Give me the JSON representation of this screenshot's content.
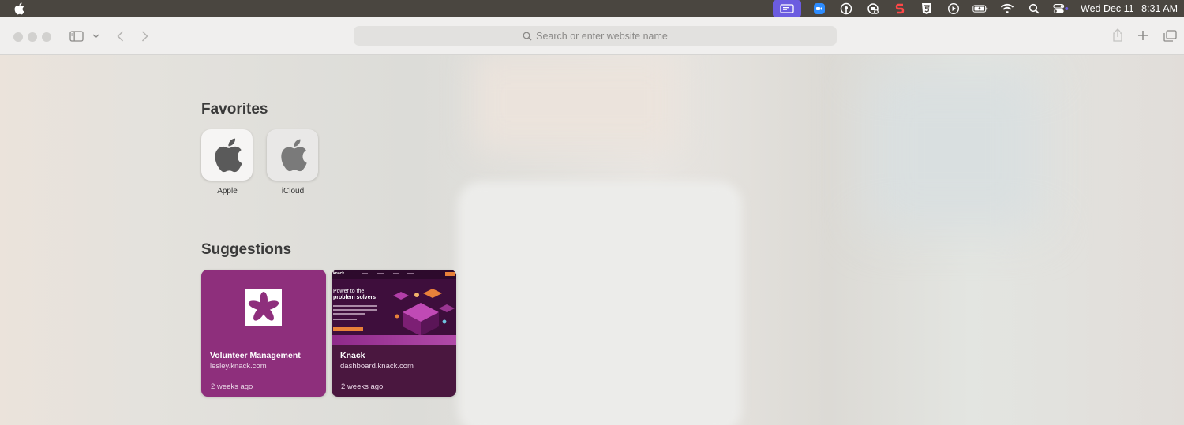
{
  "menubar": {
    "apple_icon": "apple-logo",
    "status_icons": [
      "screen-mirroring-icon",
      "zoom-icon",
      "podcast-icon",
      "copilot-icon",
      "slack-s-icon",
      "html5-icon",
      "play-icon",
      "battery-icon",
      "wifi-icon",
      "search-icon",
      "control-center-icon"
    ],
    "clock_day": "Wed Dec 11",
    "clock_time": "8:31 AM"
  },
  "toolbar": {
    "address_placeholder": "Search or enter website name"
  },
  "favorites": {
    "title": "Favorites",
    "items": [
      {
        "label": "Apple",
        "icon": "apple-logo"
      },
      {
        "label": "iCloud",
        "icon": "apple-logo"
      }
    ]
  },
  "suggestions": {
    "title": "Suggestions",
    "items": [
      {
        "title": "Volunteer Management",
        "url": "lesley.knack.com",
        "time": "2 weeks ago",
        "color": "#8e2f7c"
      },
      {
        "title": "Knack",
        "url": "dashboard.knack.com",
        "time": "2 weeks ago",
        "color": "#4a173f",
        "preview": {
          "logo": "knack",
          "headline_1": "Power to the",
          "headline_2": "problem solvers"
        }
      }
    ]
  },
  "colors": {
    "menubar": "#4a4640",
    "highlight": "#6b5ce0",
    "volunteer_card": "#8e2f7c",
    "knack_card": "#4a173f",
    "knack_orange": "#e8813a"
  }
}
